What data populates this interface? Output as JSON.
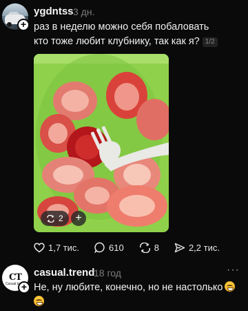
{
  "post": {
    "username": "ygdntss",
    "time": "3 дн.",
    "text_line1": "раз в неделю можно себя побаловать",
    "text_line2": "кто тоже любит клубнику, так как я?",
    "counter": "1/2",
    "photo_repost_count": "2",
    "photo_plus": "+",
    "actions": {
      "likes": "1,7 тис.",
      "comments": "610",
      "reposts": "8",
      "shares": "2,2 тис."
    }
  },
  "comment": {
    "username": "casual.trend",
    "avatar_text": "CT",
    "avatar_subtext": "Casual.trend",
    "time": "18 год",
    "more": "···",
    "text": "Не, ну любите, конечно, но не настолько"
  },
  "icons": [
    "add-follow-icon",
    "heart-icon",
    "comment-icon",
    "repost-icon",
    "share-icon",
    "more-icon",
    "repost-small-icon",
    "grin-emoji-icon"
  ],
  "colors": {
    "background": "#0a0a0a",
    "plate": "#8fd14a",
    "muted": "#7d7d7d"
  }
}
